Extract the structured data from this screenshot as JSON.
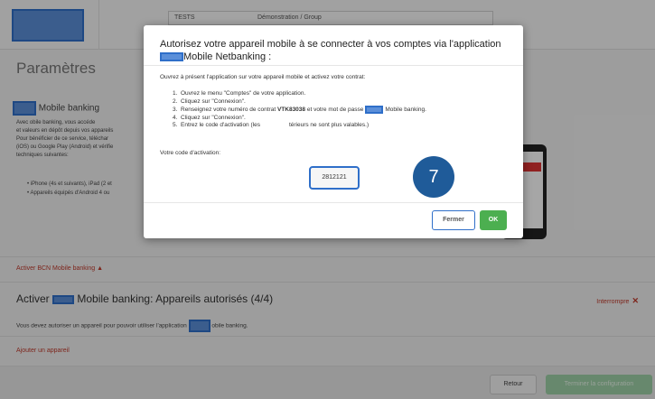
{
  "top": {
    "table_col1": "TESTS",
    "table_col2": "Démonstration / Group"
  },
  "page": {
    "title": "Paramètres",
    "section_heading": "Mobile banking",
    "section_lines": [
      "Avec        obile banking, vous accéde",
      "et valeurs en dépôt depuis vos appareils",
      "  Pour bénéficier de ce service, téléchar",
      "(iOS) ou Google Play (Android) et vérifie",
      "techniques suivantes:"
    ],
    "bullets": [
      "iPhone (4s et suivants), iPad (2 et",
      "Appareils équipés d'Android 4 ou"
    ],
    "activate_link": "Activer BCN Mobile banking",
    "activate_caret": "▲",
    "sub_title_pre": "Activer",
    "sub_title_post": "Mobile banking: Appareils autorisés (4/4)",
    "interrupt_label": "Interrompre",
    "interrupt_icon": "✕",
    "body_text_pre": "Vous devez autoriser un appareil pour pouvoir utiliser l'application",
    "body_text_post": "obile banking.",
    "add_device_link": "Ajouter un appareil",
    "btn_retour": "Retour",
    "btn_terminer": "Terminer la configuration"
  },
  "modal": {
    "title_line1": "Autorisez votre appareil mobile à se connecter à vos comptes via l'application",
    "title_line2": "Mobile Netbanking :",
    "intro": "Ouvrez à présent l'application sur votre appareil mobile et activez votre contrat:",
    "steps": [
      {
        "n": "1.",
        "text": "Ouvrez le menu \"Comptes\" de votre application."
      },
      {
        "n": "2.",
        "text": "Cliquez sur \"Connexion\"."
      },
      {
        "n": "3.",
        "pre": "Renseignez votre numéro de contrat ",
        "bold": "VTK83038",
        "post": " et votre mot de passe",
        "tail": "Mobile banking."
      },
      {
        "n": "4.",
        "text": "Cliquez sur \"Connexion\"."
      },
      {
        "n": "5.",
        "text": "Entrez le code d'activation (les",
        "tail": "térieurs ne sont plus valables.)"
      }
    ],
    "code_label": "Votre code d'activation:",
    "code_value": "2812121",
    "badge": "7",
    "btn_fermer": "Fermer",
    "btn_ok": "OK"
  },
  "colors": {
    "accent_blue": "#2f6fc9",
    "ok_green": "#4caf50",
    "link_red": "#c0392b",
    "badge_blue": "#1f5b99"
  }
}
